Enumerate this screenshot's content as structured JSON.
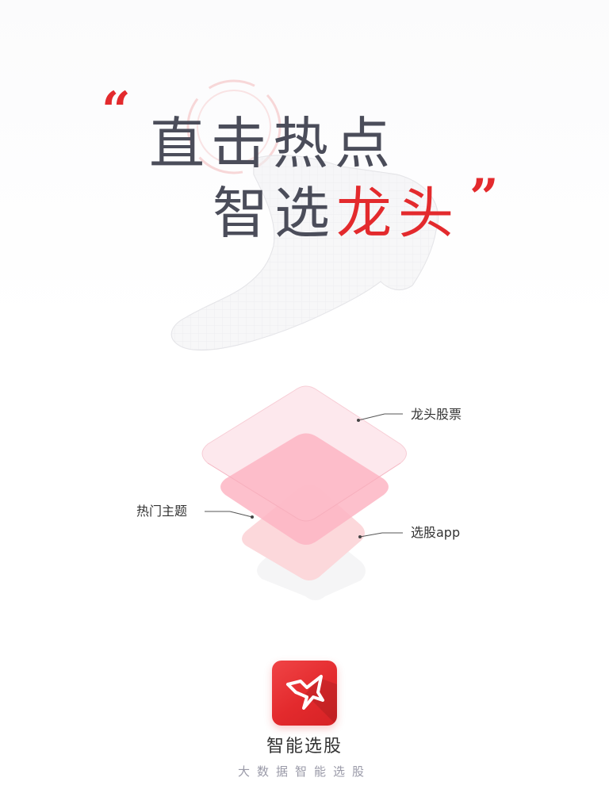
{
  "headline": {
    "quote_open": "“",
    "line1": "直击热点",
    "line2_part1": "智选",
    "line2_accent": "龙头",
    "quote_close": "”"
  },
  "callouts": {
    "top": "龙头股票",
    "left": "热门主题",
    "right": "选股app"
  },
  "app": {
    "name": "智能选股",
    "slogan": "大数据智能选股",
    "logo_icon": "arrow-logo-icon"
  },
  "colors": {
    "accent": "#e32a2d",
    "headline": "#4b4d5a",
    "layer_top": "#fde3e8",
    "layer_mid": "#fdb3c2",
    "layer_bottom": "#fcd3d6"
  }
}
